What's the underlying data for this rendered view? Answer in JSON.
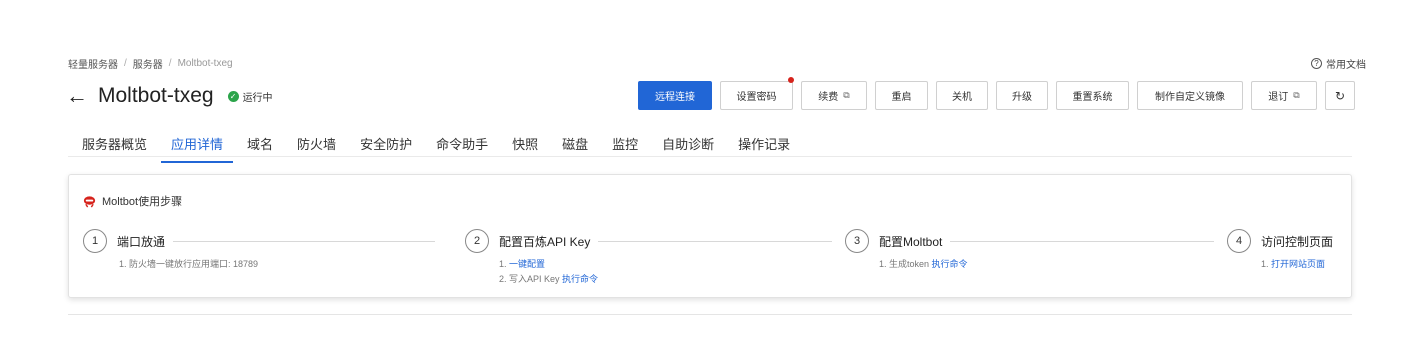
{
  "breadcrumb": {
    "items": [
      "轻量服务器",
      "服务器",
      "Moltbot-txeg"
    ]
  },
  "docs_link": {
    "label": "常用文档",
    "icon": "question-circle-icon"
  },
  "header": {
    "back_icon": "arrow-left-icon",
    "title": "Moltbot-txeg",
    "status": "运行中",
    "status_color": "#2ba44a"
  },
  "toolbar": {
    "remote": "远程连接",
    "set_password": "设置密码",
    "renew": "续费",
    "restart": "重启",
    "shutdown": "关机",
    "upgrade": "升级",
    "reset_system": "重置系统",
    "custom_image": "制作自定义镜像",
    "unsubscribe": "退订",
    "refresh_icon": "refresh-icon"
  },
  "tabs": [
    "服务器概览",
    "应用详情",
    "域名",
    "防火墙",
    "安全防护",
    "命令助手",
    "快照",
    "磁盘",
    "监控",
    "自助诊断",
    "操作记录"
  ],
  "active_tab": "应用详情",
  "card": {
    "title": "Moltbot使用步骤",
    "steps": [
      {
        "num": "1",
        "title": "端口放通",
        "lines": [
          {
            "prefix": "1. 防火墙一键放行应用端口: 18789",
            "link": ""
          }
        ]
      },
      {
        "num": "2",
        "title": "配置百炼API Key",
        "lines": [
          {
            "prefix": "1. ",
            "link": "一键配置"
          },
          {
            "prefix": "2. 写入API Key ",
            "link": "执行命令"
          }
        ]
      },
      {
        "num": "3",
        "title": "配置Moltbot",
        "lines": [
          {
            "prefix": "1. 生成token ",
            "link": "执行命令"
          }
        ]
      },
      {
        "num": "4",
        "title": "访问控制页面",
        "lines": [
          {
            "prefix": "1. ",
            "link": "打开网站页面"
          }
        ]
      }
    ]
  },
  "colors": {
    "primary": "#2166d6",
    "alert_dot": "#d6231c"
  }
}
